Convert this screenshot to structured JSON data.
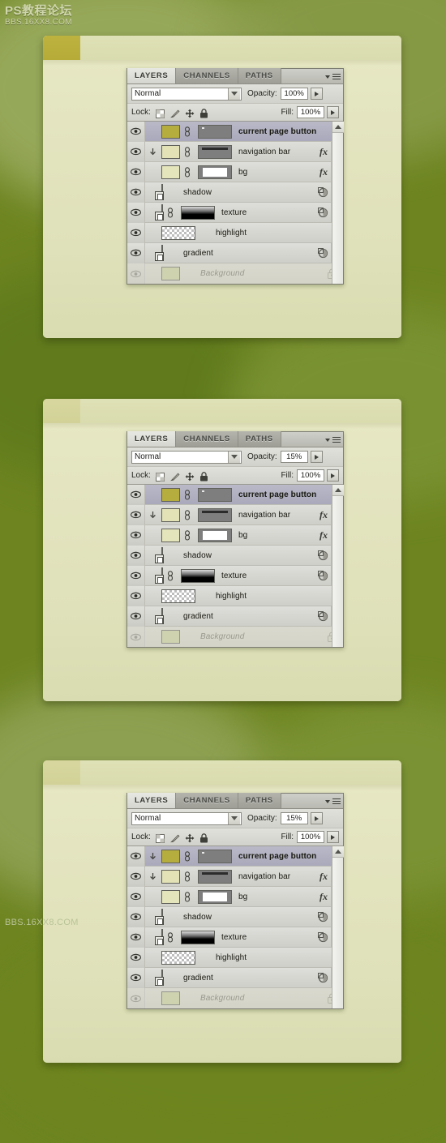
{
  "watermark": {
    "main": "PS教程论坛",
    "sub": "BBS.16XX8.COM",
    "bottom": "BBS.16XX8.COM"
  },
  "palette": {
    "tabs": [
      {
        "label": "LAYERS",
        "active": true
      },
      {
        "label": "CHANNELS",
        "active": false
      },
      {
        "label": "PATHS",
        "active": false
      }
    ],
    "menu_icon": "panel-menu-icon",
    "blend_mode": "Normal",
    "opacity_label": "Opacity:",
    "fill_label": "Fill:",
    "fill_value": "100%",
    "lock_label": "Lock:",
    "lock_icons": [
      "lock-transparent-pixels-icon",
      "lock-image-pixels-icon",
      "lock-position-icon",
      "lock-all-icon"
    ],
    "scroll_up_icon": "scroll-up-arrow-icon"
  },
  "layers": [
    {
      "name": "current page button",
      "selected": true,
      "bold": true,
      "italic": false,
      "visible": true,
      "clipped": false,
      "thumb_type": "color",
      "thumb_color": "#b5ad3d",
      "has_chain": true,
      "mask_type": "gray-dot",
      "fx": false,
      "mask_icon": false,
      "expander": false,
      "lock_icon": false
    },
    {
      "name": "navigation bar",
      "selected": false,
      "bold": false,
      "italic": false,
      "visible": true,
      "clipped": true,
      "thumb_type": "color",
      "thumb_color": "#e2e2b6",
      "has_chain": true,
      "mask_type": "gray-bar",
      "fx": true,
      "mask_icon": false,
      "expander": true,
      "lock_icon": false
    },
    {
      "name": "bg",
      "selected": false,
      "bold": false,
      "italic": false,
      "visible": true,
      "clipped": false,
      "thumb_type": "color",
      "thumb_color": "#e5e5bb",
      "has_chain": true,
      "mask_type": "white-box",
      "fx": true,
      "mask_icon": false,
      "expander": true,
      "lock_icon": false
    },
    {
      "name": "shadow",
      "selected": false,
      "bold": false,
      "italic": false,
      "visible": true,
      "clipped": false,
      "thumb_type": "checker-smart",
      "thumb_color": "",
      "has_chain": false,
      "mask_type": "none",
      "fx": false,
      "mask_icon": true,
      "expander": true,
      "lock_icon": false
    },
    {
      "name": "texture",
      "selected": false,
      "bold": false,
      "italic": false,
      "visible": true,
      "clipped": false,
      "thumb_type": "noise-smart",
      "thumb_color": "",
      "has_chain": true,
      "mask_type": "black-gradient",
      "fx": false,
      "mask_icon": true,
      "expander": true,
      "lock_icon": false
    },
    {
      "name": "highlight",
      "selected": false,
      "bold": false,
      "italic": false,
      "visible": true,
      "clipped": false,
      "thumb_type": "checker",
      "thumb_color": "",
      "has_chain": false,
      "mask_type": "none",
      "fx": false,
      "mask_icon": false,
      "expander": false,
      "lock_icon": false
    },
    {
      "name": "gradient",
      "selected": false,
      "bold": false,
      "italic": false,
      "visible": true,
      "clipped": false,
      "thumb_type": "checker-smart",
      "thumb_color": "",
      "has_chain": false,
      "mask_type": "none",
      "fx": false,
      "mask_icon": true,
      "expander": true,
      "lock_icon": false
    },
    {
      "name": "Background",
      "selected": false,
      "bold": false,
      "italic": true,
      "visible": true,
      "clipped": false,
      "thumb_type": "color",
      "thumb_color": "#c8cf95",
      "has_chain": false,
      "mask_type": "none",
      "fx": false,
      "mask_icon": false,
      "expander": false,
      "lock_icon": true
    }
  ],
  "panels": [
    {
      "id": "panel-1",
      "opacity_value": "100%",
      "tab_style": "solid",
      "clip_on_current_page_button": false
    },
    {
      "id": "panel-2",
      "opacity_value": "15%",
      "tab_style": "faint",
      "clip_on_current_page_button": false
    },
    {
      "id": "panel-3",
      "opacity_value": "15%",
      "tab_style": "faint",
      "clip_on_current_page_button": true
    }
  ],
  "colors": {
    "backdrop_green": "#6d8420",
    "backdrop_light": "#9aab5e",
    "card_cream": "#e2e4bc",
    "tab_olive": "#b5ad3d",
    "selection_blue": "#b2b2c4"
  }
}
